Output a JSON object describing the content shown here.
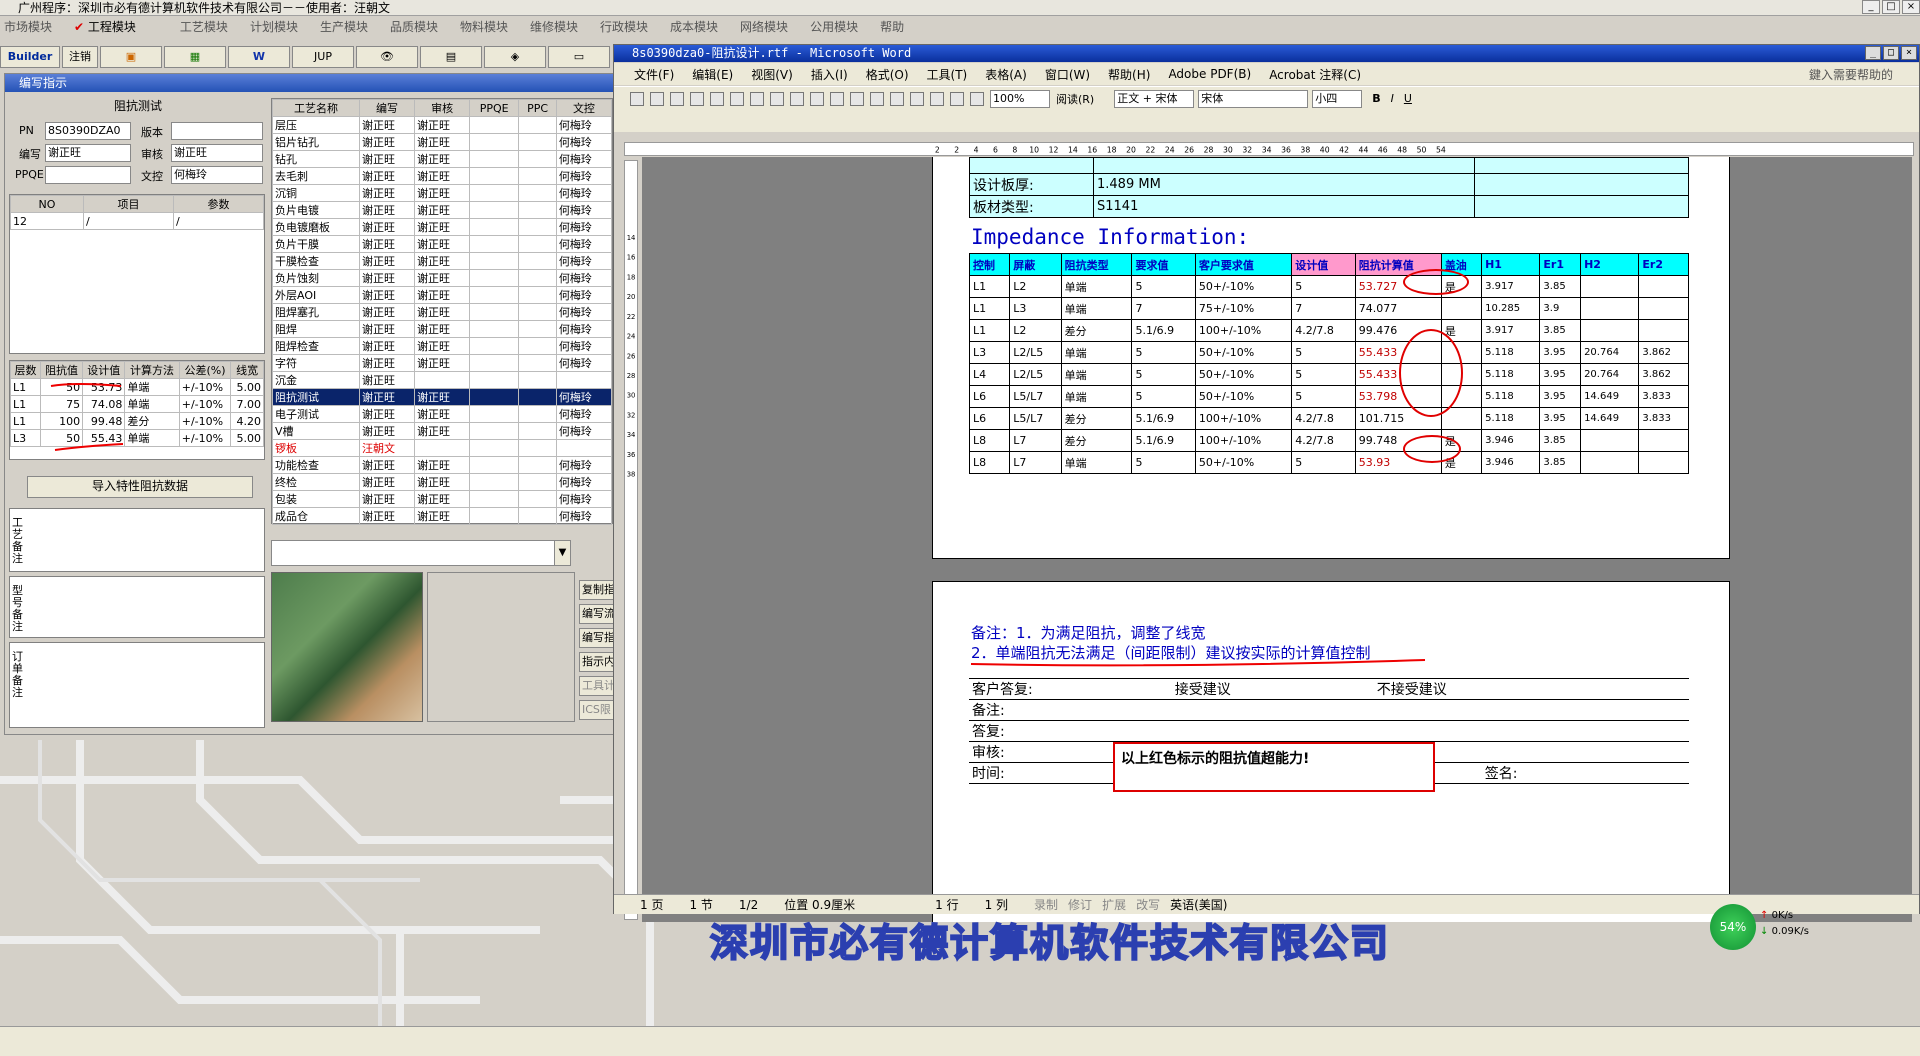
{
  "app": {
    "title": "广州程序：深圳市必有德计算机软件技术有限公司－－使用者：汪朝文",
    "menu": [
      "市场模块",
      "工程模块",
      "工艺模块",
      "计划模块",
      "生产模块",
      "品质模块",
      "物料模块",
      "维修模块",
      "行政模块",
      "成本模块",
      "网络模块",
      "公用模块",
      "帮助"
    ],
    "toolbar": [
      "Builder",
      "注销",
      "",
      "",
      "",
      "JUP",
      "",
      "",
      "",
      "",
      ""
    ]
  },
  "left": {
    "window_title": "编写指示",
    "impedance_title": "阻抗测试",
    "pn_label": "PN",
    "pn_value": "8S0390DZA0",
    "version_label": "版本",
    "version_value": "",
    "author_label": "编写",
    "author_value": "谢正旺",
    "review_label": "审核",
    "review_value": "谢正旺",
    "ppqe_label": "PPQE",
    "ppqe_value": "",
    "doc_label": "文控",
    "doc_value": "何梅玲",
    "params_headers": [
      "NO",
      "项目",
      "参数"
    ],
    "params_rows": [
      [
        "12",
        "/",
        "/"
      ]
    ],
    "imp_headers": [
      "层数",
      "阻抗值",
      "设计值",
      "计算方法",
      "公差(%)",
      "线宽"
    ],
    "imp_rows": [
      [
        "L1",
        "50",
        "53.73",
        "单端",
        "+/-10%",
        "5.00"
      ],
      [
        "L1",
        "75",
        "74.08",
        "单端",
        "+/-10%",
        "7.00"
      ],
      [
        "L1",
        "100",
        "99.48",
        "差分",
        "+/-10%",
        "4.20"
      ],
      [
        "L3",
        "50",
        "55.43",
        "单端",
        "+/-10%",
        "5.00"
      ]
    ],
    "import_button": "导入特性阻抗数据",
    "notes": [
      "工艺备注",
      "型号备注",
      "订单备注"
    ],
    "process_headers": [
      "工艺名称",
      "编写",
      "审核",
      "PPQE",
      "PPC",
      "文控"
    ],
    "process_rows": [
      [
        "层压",
        "谢正旺",
        "谢正旺",
        "",
        "",
        "何梅玲"
      ],
      [
        "铝片钻孔",
        "谢正旺",
        "谢正旺",
        "",
        "",
        "何梅玲"
      ],
      [
        "钻孔",
        "谢正旺",
        "谢正旺",
        "",
        "",
        "何梅玲"
      ],
      [
        "去毛刺",
        "谢正旺",
        "谢正旺",
        "",
        "",
        "何梅玲"
      ],
      [
        "沉铜",
        "谢正旺",
        "谢正旺",
        "",
        "",
        "何梅玲"
      ],
      [
        "负片电镀",
        "谢正旺",
        "谢正旺",
        "",
        "",
        "何梅玲"
      ],
      [
        "负电镀磨板",
        "谢正旺",
        "谢正旺",
        "",
        "",
        "何梅玲"
      ],
      [
        "负片干膜",
        "谢正旺",
        "谢正旺",
        "",
        "",
        "何梅玲"
      ],
      [
        "干膜检查",
        "谢正旺",
        "谢正旺",
        "",
        "",
        "何梅玲"
      ],
      [
        "负片蚀刻",
        "谢正旺",
        "谢正旺",
        "",
        "",
        "何梅玲"
      ],
      [
        "外层AOI",
        "谢正旺",
        "谢正旺",
        "",
        "",
        "何梅玲"
      ],
      [
        "阻焊塞孔",
        "谢正旺",
        "谢正旺",
        "",
        "",
        "何梅玲"
      ],
      [
        "阻焊",
        "谢正旺",
        "谢正旺",
        "",
        "",
        "何梅玲"
      ],
      [
        "阻焊检查",
        "谢正旺",
        "谢正旺",
        "",
        "",
        "何梅玲"
      ],
      [
        "字符",
        "谢正旺",
        "谢正旺",
        "",
        "",
        "何梅玲"
      ],
      [
        "沉金",
        "谢正旺",
        "",
        "",
        "",
        ""
      ],
      [
        "阻抗测试",
        "谢正旺",
        "谢正旺",
        "",
        "",
        "何梅玲"
      ],
      [
        "电子测试",
        "谢正旺",
        "谢正旺",
        "",
        "",
        "何梅玲"
      ],
      [
        "V槽",
        "谢正旺",
        "谢正旺",
        "",
        "",
        "何梅玲"
      ],
      [
        "锣板",
        "汪朝文",
        "",
        "",
        "",
        ""
      ],
      [
        "功能检查",
        "谢正旺",
        "谢正旺",
        "",
        "",
        "何梅玲"
      ],
      [
        "终检",
        "谢正旺",
        "谢正旺",
        "",
        "",
        "何梅玲"
      ],
      [
        "包装",
        "谢正旺",
        "谢正旺",
        "",
        "",
        "何梅玲"
      ],
      [
        "成品仓",
        "谢正旺",
        "谢正旺",
        "",
        "",
        "何梅玲"
      ]
    ],
    "side_buttons": [
      "复制指",
      "编写流",
      "编写指",
      "指示内",
      "工具计",
      "ICS限"
    ]
  },
  "word": {
    "title": "8s0390dza0-阻抗设计.rtf - Microsoft Word",
    "menu": [
      "文件(F)",
      "编辑(E)",
      "视图(V)",
      "插入(I)",
      "格式(O)",
      "工具(T)",
      "表格(A)",
      "窗口(W)",
      "帮助(H)",
      "Adobe PDF(B)",
      "Acrobat 注释(C)"
    ],
    "help_box": "鍵入需要帮助的",
    "zoom": "100%",
    "read": "阅读(R)",
    "style": "正文 + 宋体",
    "font": "宋体",
    "size": "小四",
    "ruler_ticks": [
      "2",
      "2",
      "4",
      "6",
      "8",
      "10",
      "12",
      "14",
      "16",
      "18",
      "20",
      "22",
      "24",
      "26",
      "28",
      "30",
      "32",
      "34",
      "36",
      "38",
      "40",
      "42",
      "44",
      "46",
      "48",
      "50",
      "54"
    ],
    "vruler_ticks": [
      "14",
      "16",
      "18",
      "20",
      "22",
      "24",
      "26",
      "28",
      "30",
      "32",
      "34",
      "36",
      "38"
    ],
    "thickness_label": "设计板厚:",
    "thickness_value": "1.489 MM",
    "material_label": "板材类型:",
    "material_value": "S1141",
    "imp_heading": "Impedance Information:",
    "table_headers": [
      "控制",
      "屏蔽",
      "阻抗类型",
      "要求值",
      "客户要求值",
      "设计值",
      "阻抗计算值",
      "盖油",
      "H1",
      "Er1",
      "H2",
      "Er2"
    ],
    "table_rows": [
      [
        "L1",
        "L2",
        "单端",
        "5",
        "50+/-10%",
        "5",
        "53.727",
        "是",
        "3.917",
        "3.85",
        "",
        ""
      ],
      [
        "L1",
        "L3",
        "单端",
        "7",
        "75+/-10%",
        "7",
        "74.077",
        "",
        "10.285",
        "3.9",
        "",
        ""
      ],
      [
        "L1",
        "L2",
        "差分",
        "5.1/6.9",
        "100+/-10%",
        "4.2/7.8",
        "99.476",
        "是",
        "3.917",
        "3.85",
        "",
        ""
      ],
      [
        "L3",
        "L2/L5",
        "单端",
        "5",
        "50+/-10%",
        "5",
        "55.433",
        "",
        "5.118",
        "3.95",
        "20.764",
        "3.862"
      ],
      [
        "L4",
        "L2/L5",
        "单端",
        "5",
        "50+/-10%",
        "5",
        "55.433",
        "",
        "5.118",
        "3.95",
        "20.764",
        "3.862"
      ],
      [
        "L6",
        "L5/L7",
        "单端",
        "5",
        "50+/-10%",
        "5",
        "53.798",
        "",
        "5.118",
        "3.95",
        "14.649",
        "3.833"
      ],
      [
        "L6",
        "L5/L7",
        "差分",
        "5.1/6.9",
        "100+/-10%",
        "4.2/7.8",
        "101.715",
        "",
        "5.118",
        "3.95",
        "14.649",
        "3.833"
      ],
      [
        "L8",
        "L7",
        "差分",
        "5.1/6.9",
        "100+/-10%",
        "4.2/7.8",
        "99.748",
        "是",
        "3.946",
        "3.85",
        "",
        ""
      ],
      [
        "L8",
        "L7",
        "单端",
        "5",
        "50+/-10%",
        "5",
        "53.93",
        "是",
        "3.946",
        "3.85",
        "",
        ""
      ]
    ],
    "red_rows": [
      0,
      3,
      4,
      5,
      8
    ],
    "note1": "备注：1．为满足阻抗，调整了线宽",
    "note2": "2．单端阻抗无法满足（间距限制）建议按实际的计算值控制",
    "reply_label": "客户答复:",
    "accept": "接受建议",
    "reject": "不接受建议",
    "remark_label": "备注:",
    "answer_label": "答复:",
    "review_label": "审核:",
    "time_label": "时间:",
    "sign_label": "签名:",
    "warning": "以上红色标示的阻抗值超能力!",
    "status": [
      "1 页",
      "1 节",
      "1/2",
      "位置 0.9厘米",
      "1 行",
      "1 列",
      "录制",
      "修订",
      "扩展",
      "改写",
      "英语(美国)"
    ]
  },
  "watermark": "深圳市必有德计算机软件技术有限公司",
  "netmon": {
    "percent": "54%",
    "up": "0K/s",
    "down": "0.09K/s"
  }
}
